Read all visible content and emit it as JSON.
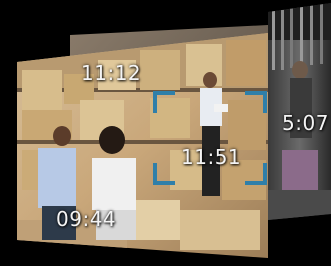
{
  "frames": [
    {
      "id": "back",
      "timestamp": "5:07"
    },
    {
      "id": "top",
      "timestamp": "11:12"
    },
    {
      "id": "center",
      "timestamp": "11:51"
    },
    {
      "id": "bottom",
      "timestamp": "09:44"
    }
  ],
  "colors": {
    "background": "#000000",
    "focus_bracket": "#2f7fa9",
    "timestamp_text": "#f4f4f4"
  }
}
